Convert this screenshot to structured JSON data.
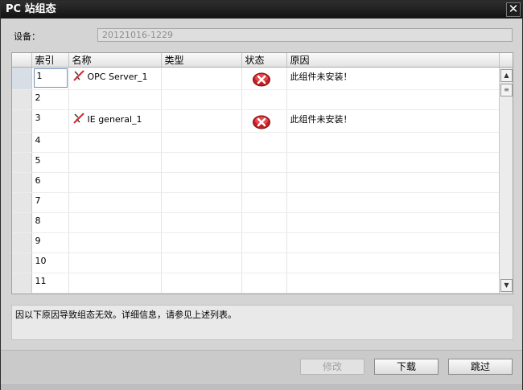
{
  "window": {
    "title": "PC 站组态",
    "close_glyph": "✕"
  },
  "device": {
    "label": "设备：",
    "value": "20121016-1229"
  },
  "grid": {
    "columns": {
      "index": "索引",
      "name": "名称",
      "type": "类型",
      "status": "状态",
      "reason": "原因"
    },
    "rows": [
      {
        "index": "1",
        "name": "OPC Server_1",
        "type": "",
        "status_icon": "error-icon",
        "reason": "此组件未安装！",
        "warn_icon": "missing-component-icon"
      },
      {
        "index": "2",
        "name": "",
        "type": "",
        "status_icon": "",
        "reason": ""
      },
      {
        "index": "3",
        "name": "IE general_1",
        "type": "",
        "status_icon": "error-icon",
        "reason": "此组件未安装！",
        "warn_icon": "missing-component-icon"
      },
      {
        "index": "4",
        "name": "",
        "type": "",
        "status_icon": "",
        "reason": ""
      },
      {
        "index": "5",
        "name": "",
        "type": "",
        "status_icon": "",
        "reason": ""
      },
      {
        "index": "6",
        "name": "",
        "type": "",
        "status_icon": "",
        "reason": ""
      },
      {
        "index": "7",
        "name": "",
        "type": "",
        "status_icon": "",
        "reason": ""
      },
      {
        "index": "8",
        "name": "",
        "type": "",
        "status_icon": "",
        "reason": ""
      },
      {
        "index": "9",
        "name": "",
        "type": "",
        "status_icon": "",
        "reason": ""
      },
      {
        "index": "10",
        "name": "",
        "type": "",
        "status_icon": "",
        "reason": ""
      },
      {
        "index": "11",
        "name": "",
        "type": "",
        "status_icon": "",
        "reason": ""
      }
    ]
  },
  "message": "因以下原因导致组态无效。详细信息，请参见上述列表。",
  "buttons": {
    "modify": "修改",
    "download": "下载",
    "skip": "跳过"
  },
  "colors": {
    "titlebar": "#1c1c1c",
    "error_red": "#d9262a",
    "window_bg": "#d4d4d4"
  }
}
